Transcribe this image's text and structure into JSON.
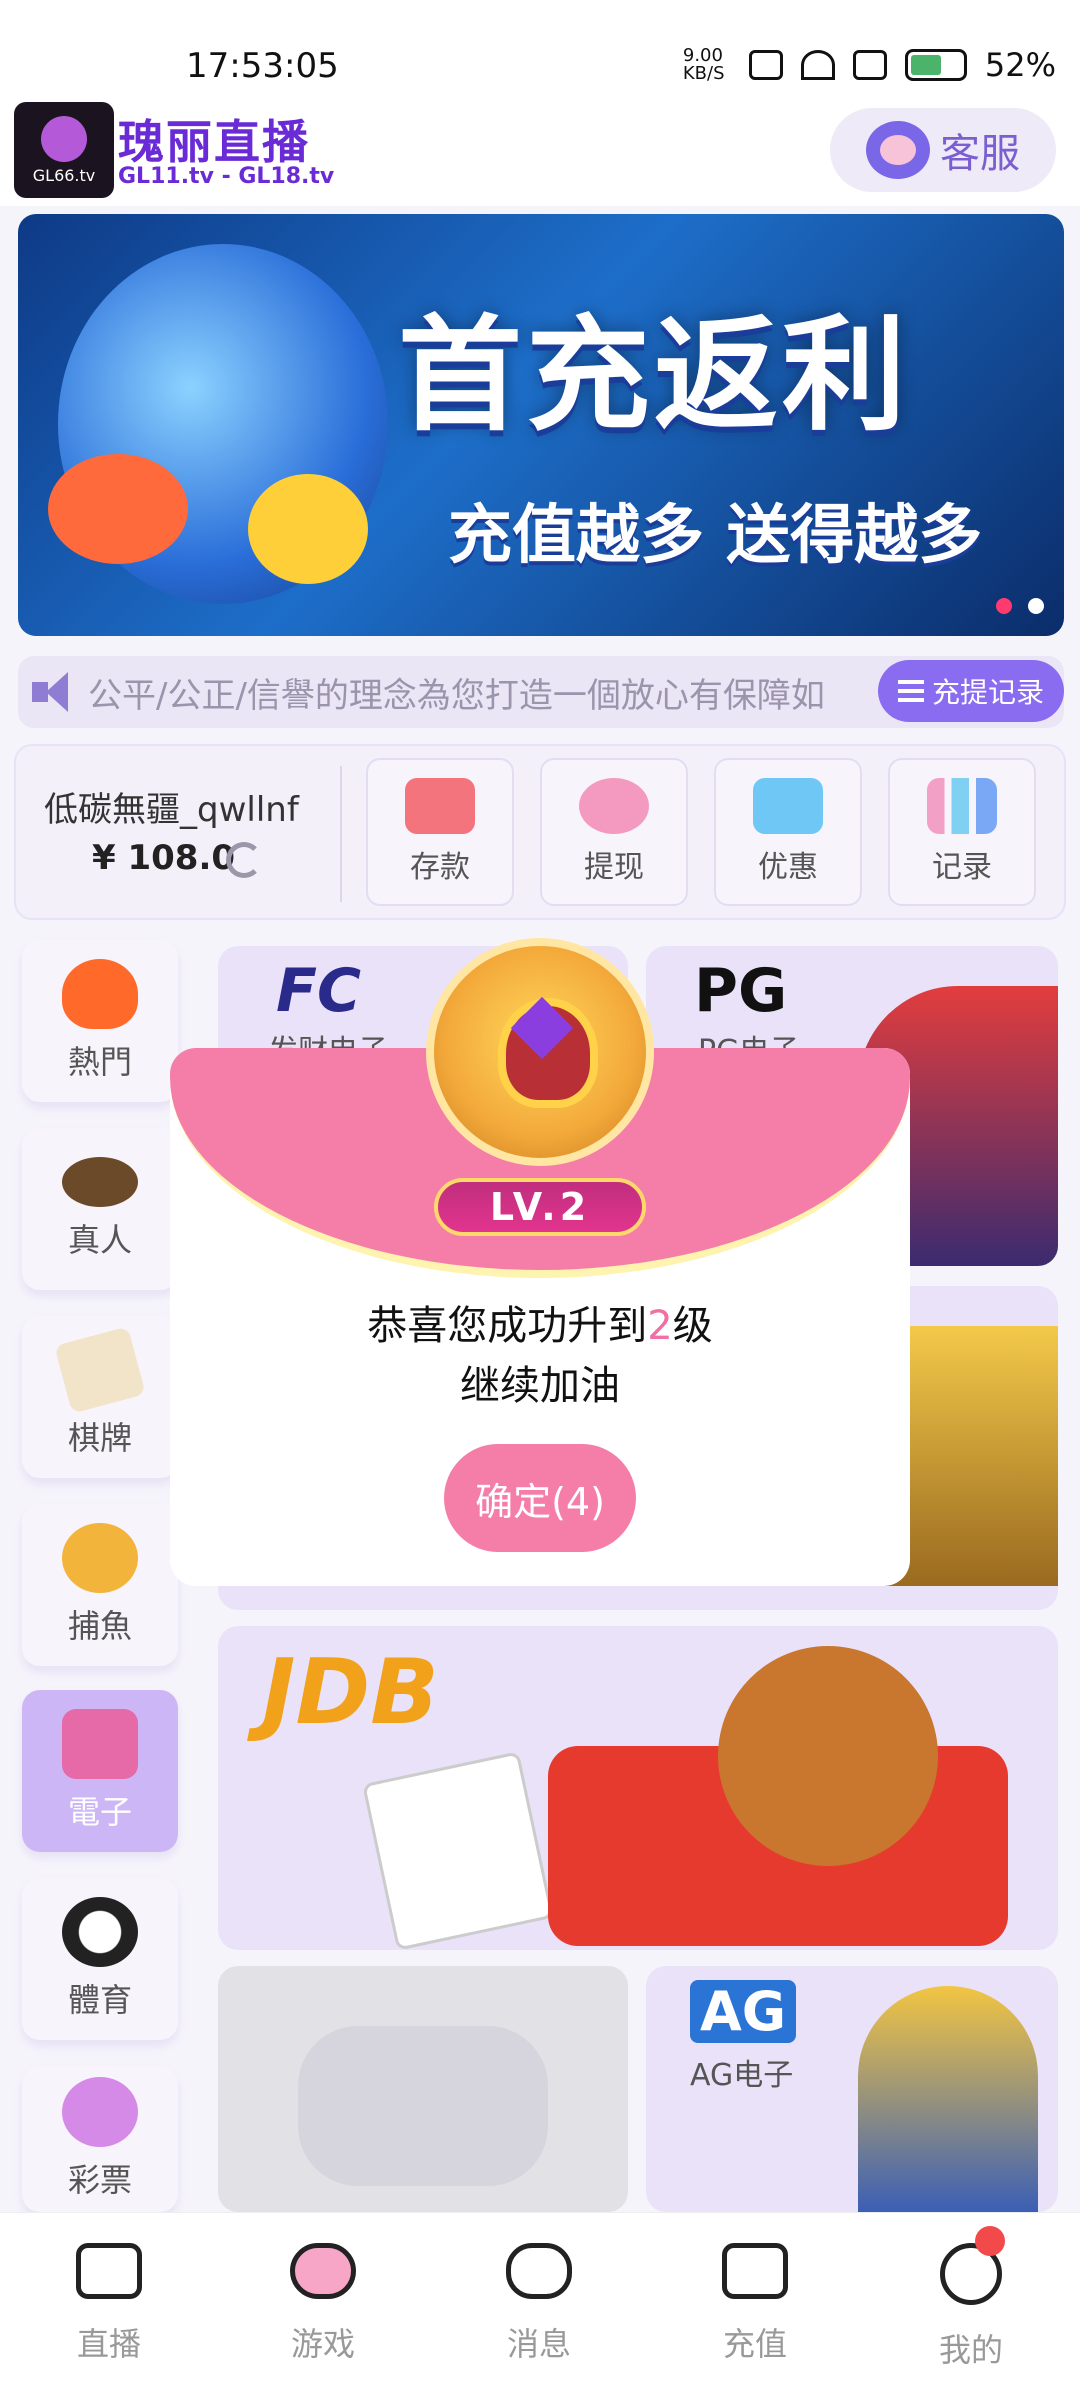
{
  "status_bar": {
    "time": "17:53:05",
    "net_speed": "9.00 KB/S",
    "battery": "52%"
  },
  "header": {
    "logo_text": "GL66.tv",
    "brand": "瑰丽直播",
    "domains": "GL11.tv - GL18.tv",
    "service_label": "客服"
  },
  "banner": {
    "title": "首充返利",
    "subtitle": "充值越多 送得越多"
  },
  "marquee": {
    "text": "公平/公正/信譽的理念為您打造一個放心有保障如",
    "record_button": "充提记录"
  },
  "account": {
    "username": "低碳無疆_qwllnf",
    "balance": "¥ 108.0",
    "actions": [
      {
        "label": "存款",
        "icon": "card-icon",
        "color": "#f4747d"
      },
      {
        "label": "提现",
        "icon": "money-bag-icon",
        "color": "#f49ac0"
      },
      {
        "label": "优惠",
        "icon": "gift-icon",
        "color": "#6ec7f5"
      },
      {
        "label": "记录",
        "icon": "bar-chart-icon",
        "color": "#8fb8f5"
      }
    ]
  },
  "side_nav": [
    {
      "label": "熱門",
      "icon": "flame-icon",
      "color": "#ff6a2a"
    },
    {
      "label": "真人",
      "icon": "chip-icon",
      "color": "#6b4a2a"
    },
    {
      "label": "棋牌",
      "icon": "card-ace-icon",
      "color": "#f2e4c8"
    },
    {
      "label": "捕魚",
      "icon": "shark-icon",
      "color": "#f3b43c"
    },
    {
      "label": "電子",
      "icon": "slot-machine-icon",
      "color": "#e76aa8"
    },
    {
      "label": "體育",
      "icon": "soccer-ball-icon",
      "color": "#222222"
    },
    {
      "label": "彩票",
      "icon": "lottery-ball-icon",
      "color": "#d58ae8"
    }
  ],
  "games": [
    {
      "logo": "FC",
      "label": "发财电子"
    },
    {
      "logo": "PG",
      "label": "PG电子"
    },
    {
      "logo": "JDB",
      "label": ""
    },
    {
      "logo": "AG",
      "label": "AG电子"
    }
  ],
  "modal": {
    "level": "LV.2",
    "msg_prefix": "恭喜您成功升到",
    "msg_level": "2",
    "msg_suffix": "级",
    "msg_line2": "继续加油",
    "confirm": "确定(4)"
  },
  "tabbar": [
    {
      "label": "直播",
      "icon": "video-icon"
    },
    {
      "label": "游戏",
      "icon": "gamepad-icon"
    },
    {
      "label": "消息",
      "icon": "chat-icon"
    },
    {
      "label": "充值",
      "icon": "wallet-icon"
    },
    {
      "label": "我的",
      "icon": "smile-icon"
    }
  ]
}
